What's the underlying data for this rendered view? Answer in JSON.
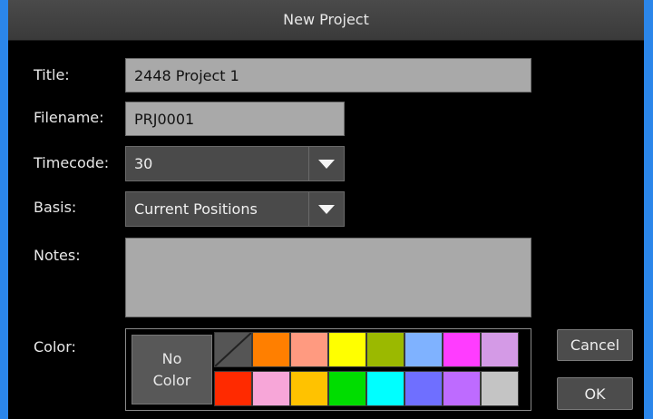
{
  "dialog": {
    "title": "New Project"
  },
  "form": {
    "title_label": "Title:",
    "title_value": "2448 Project 1",
    "filename_label": "Filename:",
    "filename_value": "PRJ0001",
    "timecode_label": "Timecode:",
    "timecode_value": "30",
    "basis_label": "Basis:",
    "basis_value": "Current Positions",
    "notes_label": "Notes:",
    "notes_value": "",
    "color_label": "Color:"
  },
  "palette": {
    "no_color_line1": "No",
    "no_color_line2": "Color",
    "row1": [
      "none-diagonal",
      "#ff7f00",
      "#ff9a80",
      "#ffff00",
      "#9bb900",
      "#7fb2ff",
      "#ff3cff",
      "#d49ae6"
    ],
    "row2": [
      "#ff2a00",
      "#f7a6d8",
      "#ffc200",
      "#00dd00",
      "#00ffff",
      "#6f6fff",
      "#be6bff",
      "#c4c4c4"
    ]
  },
  "buttons": {
    "cancel": "Cancel",
    "ok": "OK"
  },
  "colors": {
    "accent": "#2b86ea",
    "field_bg": "#a9a9a9",
    "dropdown_bg": "#4a4a4a"
  },
  "icons": {
    "dropdown": "chevron-down-icon"
  }
}
